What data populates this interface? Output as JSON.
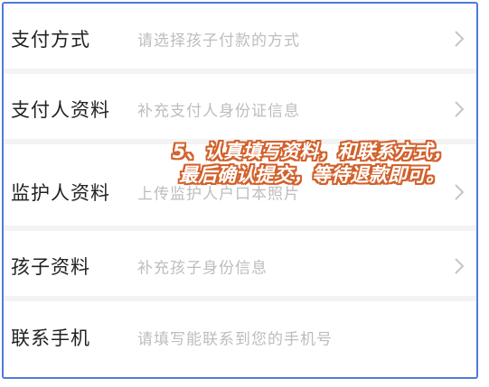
{
  "form": {
    "rows": [
      {
        "label": "支付方式",
        "placeholder": "请选择孩子付款的方式",
        "chevron": true
      },
      {
        "label": "支付人资料",
        "placeholder": "补充支付人身份证信息",
        "chevron": true
      },
      {
        "label": "监护人资料",
        "placeholder": "上传监护人户口本照片",
        "chevron": true
      },
      {
        "label": "孩子资料",
        "placeholder": "补充孩子身份信息",
        "chevron": true
      },
      {
        "label": "联系手机",
        "placeholder": "请填写能联系到您的手机号",
        "chevron": false
      }
    ]
  },
  "overlay": {
    "line1": "5、认真填写资料，和联系方式，",
    "line2": "最后确认提交，等待退款即可。",
    "stroke_color": "#d2612b"
  },
  "colors": {
    "frame_border": "#4d7bd9",
    "label": "#222222",
    "placeholder": "#bdbdbd",
    "chevron": "#c4c4c4",
    "divider": "#f3f3f5"
  }
}
